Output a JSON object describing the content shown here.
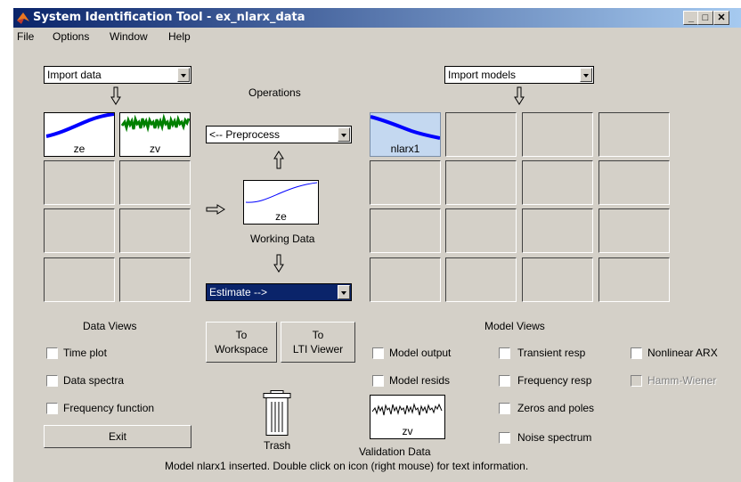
{
  "window": {
    "title": "System Identification Tool - ex_nlarx_data",
    "controls": [
      "_",
      "□",
      "✕"
    ]
  },
  "menu": [
    "File",
    "Options",
    "Window",
    "Help"
  ],
  "data_panel": {
    "import_select": "Import data",
    "data_items": [
      {
        "label": "ze",
        "color": "#0000ff"
      },
      {
        "label": "zv",
        "color": "#008000"
      }
    ],
    "section_label": "Data Views",
    "views": [
      "Time plot",
      "Data spectra",
      "Frequency function"
    ],
    "exit_label": "Exit"
  },
  "operations": {
    "label": "Operations",
    "preprocess_select": "<-- Preprocess",
    "working_data": {
      "item": "ze",
      "caption": "Working Data"
    },
    "estimate_select": "Estimate -->",
    "to_workspace": [
      "To",
      "Workspace"
    ],
    "to_lti": [
      "To",
      "LTI Viewer"
    ],
    "trash_label": "Trash",
    "validation": {
      "item": "zv",
      "caption": "Validation Data"
    }
  },
  "models_panel": {
    "import_select": "Import models",
    "model_items": [
      {
        "label": "nlarx1",
        "color": "#0000ff"
      }
    ],
    "section_label": "Model Views",
    "views_col1": [
      "Model output",
      "Model resids"
    ],
    "views_col2": [
      "Transient resp",
      "Frequency resp",
      "Zeros and poles",
      "Noise spectrum"
    ],
    "views_col3": [
      {
        "label": "Nonlinear ARX",
        "enabled": true
      },
      {
        "label": "Hamm-Wiener",
        "enabled": false
      }
    ]
  },
  "status": "Model nlarx1 inserted.  Double click on icon (right mouse) for text information."
}
